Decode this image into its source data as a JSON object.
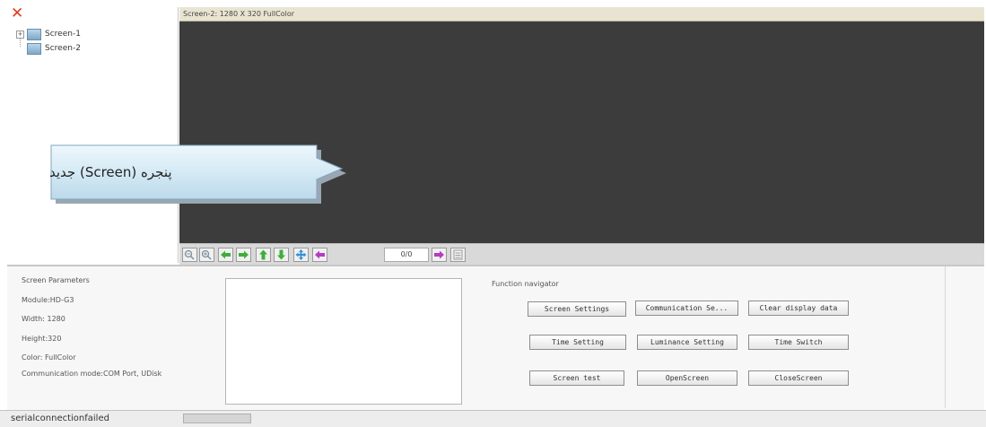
{
  "tree": {
    "items": [
      {
        "label": "Screen-1",
        "expander": "+"
      },
      {
        "label": "Screen-2"
      }
    ]
  },
  "preview": {
    "title": "Screen-2: 1280 X 320 FullColor",
    "page_counter": "0/0"
  },
  "toolbar": {
    "icons": [
      "zoom-out-icon",
      "zoom-in-icon",
      "arrow-left-icon",
      "arrow-right-icon",
      "arrow-up-icon",
      "arrow-down-icon",
      "move-icon",
      "arrow-left-icon",
      "arrow-right-icon",
      "list-icon"
    ]
  },
  "callout": {
    "text": "پنجره (Screen) جدید"
  },
  "params": {
    "title": "Screen Parameters",
    "module": "Module:HD-G3",
    "width": "Width: 1280",
    "height": "Height:320",
    "color": "Color: FullColor",
    "comm": "Communication mode:COM Port, UDisk"
  },
  "nav": {
    "title": "Function navigator",
    "buttons": [
      "Screen Settings",
      "Communication Se...",
      "Clear display data",
      "Time Setting",
      "Luminance Setting",
      "Time Switch",
      "Screen test",
      "OpenScreen",
      "CloseScreen"
    ]
  },
  "status": {
    "text": "serialconnectionfailed"
  },
  "colors": {
    "canvas": "#3c3c3c",
    "title_bar": "#e9e4d2",
    "callout_fill": "#d8ecf6",
    "close_icon": "#e03a1e"
  }
}
